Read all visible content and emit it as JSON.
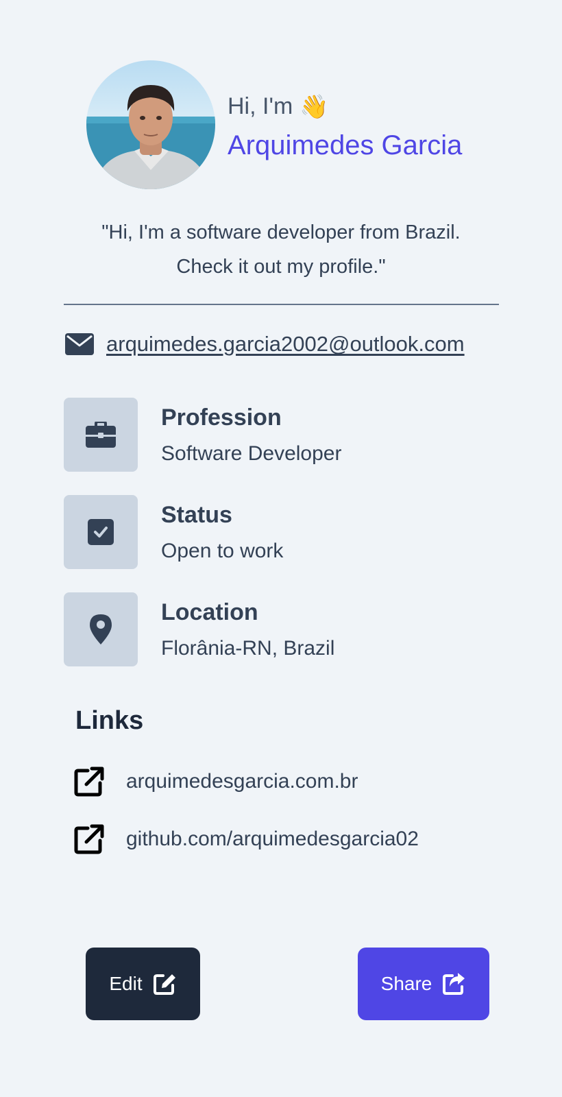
{
  "profile": {
    "greeting": "Hi, I'm",
    "wave": "👋",
    "name": "Arquimedes Garcia",
    "bio_line1": "\"Hi, I'm a software developer from Brazil.",
    "bio_line2": "Check it out my profile.\"",
    "email": "arquimedes.garcia2002@outlook.com",
    "avatar_icon": "profile-photo"
  },
  "info": [
    {
      "title": "Profession",
      "value": "Software Developer",
      "icon": "briefcase-icon"
    },
    {
      "title": "Status",
      "value": "Open to work",
      "icon": "checkbox-icon"
    },
    {
      "title": "Location",
      "value": "Florânia-RN, Brazil",
      "icon": "location-pin-icon"
    }
  ],
  "links": {
    "title": "Links",
    "items": [
      {
        "label": "arquimedesgarcia.com.br",
        "icon": "external-link-icon"
      },
      {
        "label": "github.com/arquimedesgarcia02",
        "icon": "external-link-icon"
      }
    ]
  },
  "actions": {
    "edit_label": "Edit",
    "share_label": "Share"
  },
  "colors": {
    "background": "#f0f4f8",
    "accent": "#4f46e5",
    "dark": "#1e293b",
    "icon_box": "#cbd5e1"
  }
}
